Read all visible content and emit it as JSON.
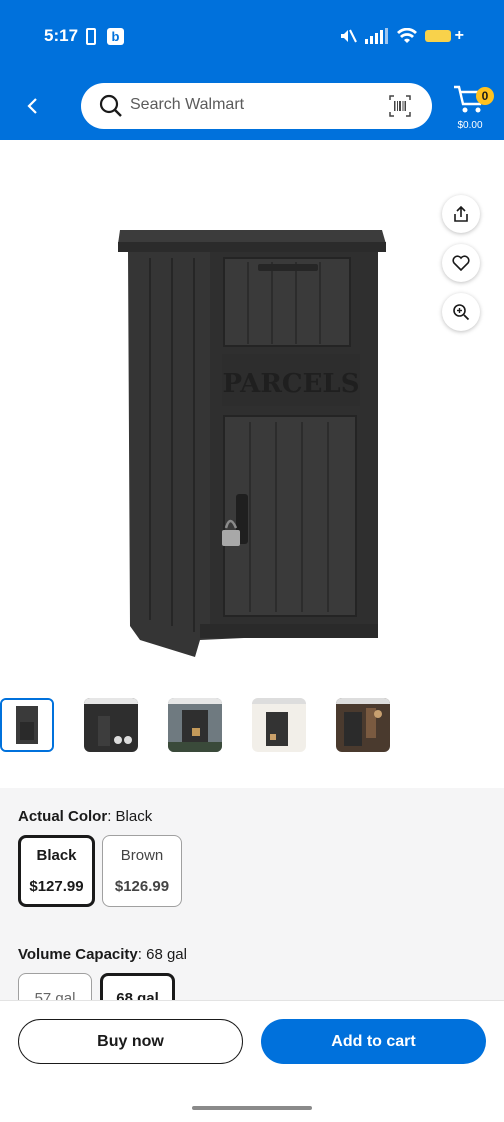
{
  "status_bar": {
    "time": "5:17",
    "b_badge": "b",
    "icons": [
      "battery-saver-icon",
      "b-app-icon",
      "mute-icon",
      "signal-icon",
      "wifi-icon",
      "battery-icon"
    ]
  },
  "header": {
    "search_placeholder": "Search Walmart",
    "cart_count": "0",
    "cart_total": "$0.00",
    "brand_color": "#0071dc",
    "badge_color": "#ffc220"
  },
  "product": {
    "image_label": "PARCELS"
  },
  "options": {
    "color": {
      "label": "Actual Color",
      "value": "Black",
      "variants": [
        {
          "name": "Black",
          "price": "$127.99",
          "selected": true
        },
        {
          "name": "Brown",
          "price": "$126.99",
          "selected": false
        }
      ]
    },
    "capacity": {
      "label": "Volume Capacity",
      "value": "68 gal",
      "variants": [
        {
          "name": "57 gal",
          "selected": false
        },
        {
          "name": "68 gal",
          "selected": true
        }
      ]
    }
  },
  "actions": {
    "buy_now": "Buy now",
    "add_to_cart": "Add to cart"
  }
}
